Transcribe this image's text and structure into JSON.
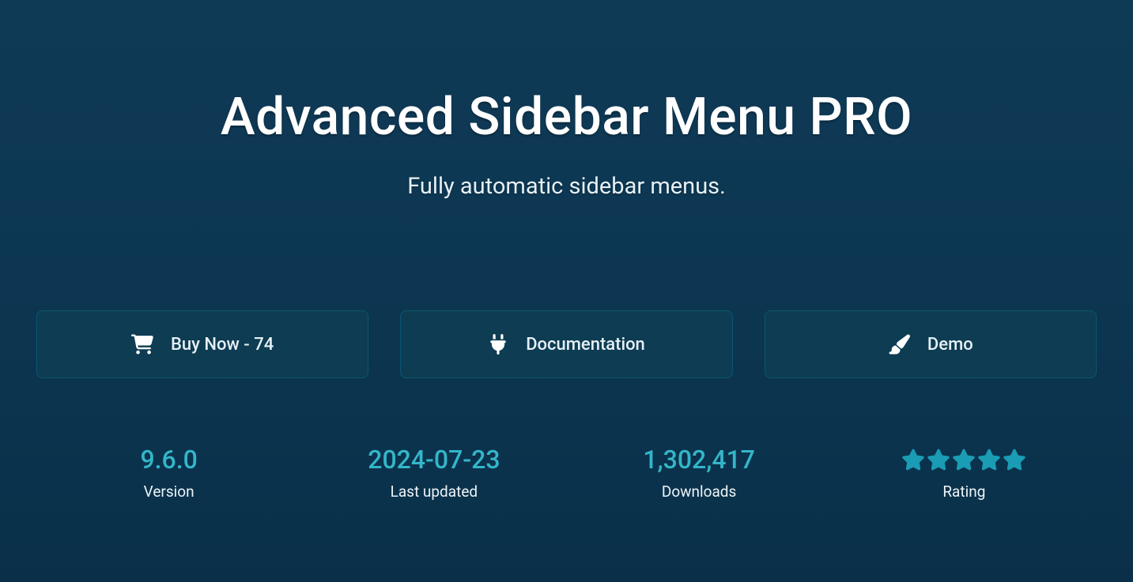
{
  "hero": {
    "title": "Advanced Sidebar Menu PRO",
    "subtitle": "Fully automatic sidebar menus."
  },
  "buttons": {
    "buy_now": "Buy Now - 74",
    "documentation": "Documentation",
    "demo": "Demo"
  },
  "stats": {
    "version": {
      "value": "9.6.0",
      "label": "Version"
    },
    "updated": {
      "value": "2024-07-23",
      "label": "Last updated"
    },
    "downloads": {
      "value": "1,302,417",
      "label": "Downloads"
    },
    "rating": {
      "stars": 5,
      "label": "Rating"
    }
  },
  "colors": {
    "accent": "#34b6c9",
    "star": "#1a9cb5"
  }
}
